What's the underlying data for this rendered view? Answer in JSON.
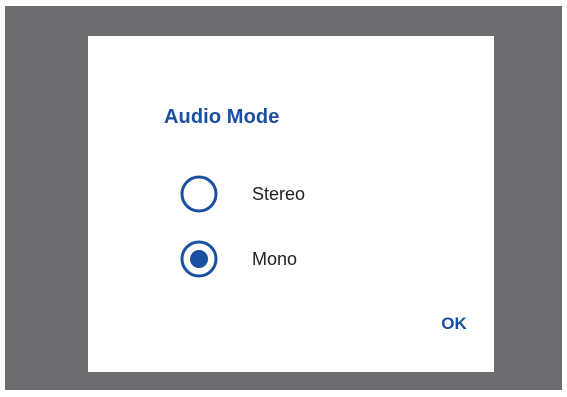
{
  "dialog": {
    "title": "Audio Mode",
    "options": [
      {
        "label": "Stereo",
        "selected": false
      },
      {
        "label": "Mono",
        "selected": true
      }
    ],
    "ok_label": "OK"
  },
  "colors": {
    "backdrop": "#6b6c70",
    "dialog_bg": "#ffffff",
    "accent": "#1b4fa0",
    "text": "#1f1f1f"
  },
  "icons": {
    "unselected": "radio-unchecked-icon",
    "selected": "radio-checked-icon"
  }
}
